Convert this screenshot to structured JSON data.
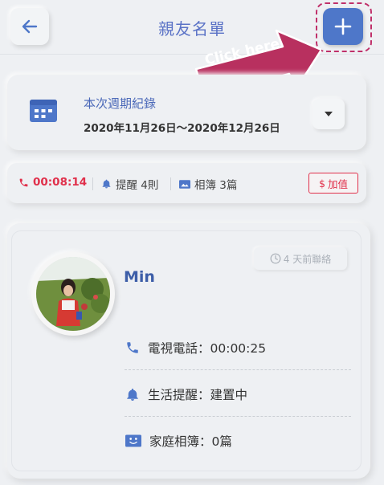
{
  "header": {
    "title": "親友名單",
    "back_icon": "arrow-left-icon",
    "add_icon": "plus-icon"
  },
  "callout": {
    "text": "Click  here"
  },
  "period": {
    "label": "本次週期紀錄",
    "range": "2020年11月26日～2020年12月26日",
    "icon": "calendar-icon",
    "dropdown_icon": "caret-down-icon"
  },
  "stats": {
    "call_time": "00:08:14",
    "reminders": "提醒 4則",
    "albums": "相簿 3篇",
    "topup_label": "加值",
    "topup_symbol": "$"
  },
  "contact": {
    "name": "Min",
    "last_contact": "4 天前聯絡",
    "video_call": "電視電話：00:00:25",
    "life_reminder": "生活提醒：建置中",
    "family_album": "家庭相簿：0篇"
  },
  "colors": {
    "accent": "#4e77c9",
    "title": "#5a72c6",
    "alert": "#e0304b",
    "callout": "#b8305f"
  }
}
